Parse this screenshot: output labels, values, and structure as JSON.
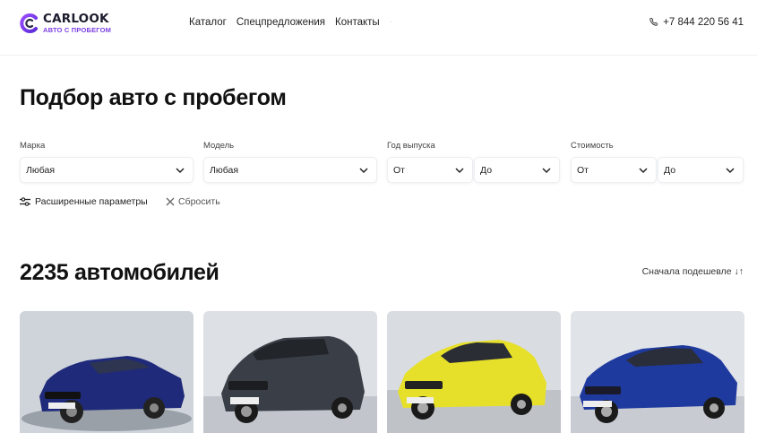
{
  "header": {
    "logo_title": "CARLOOK",
    "logo_subtitle": "АВТО С ПРОБЕГОМ",
    "nav": [
      "Каталог",
      "Спецпредложения",
      "Контакты"
    ],
    "phone": "+7 844 220 56 41"
  },
  "main": {
    "title": "Подбор авто с пробегом",
    "filters": {
      "brand": {
        "label": "Марка",
        "value": "Любая"
      },
      "model": {
        "label": "Модель",
        "value": "Любая"
      },
      "year": {
        "label": "Год выпуска",
        "from": "От",
        "to": "До"
      },
      "price": {
        "label": "Стоимость",
        "from": "От",
        "to": "До"
      }
    },
    "advanced_label": "Расширенные параметры",
    "reset_label": "Сбросить",
    "count_title": "2235 автомобилей",
    "sort_label": "Сначала подешевле ↓↑"
  },
  "cars": [
    {
      "color": "#1f2b7a",
      "bg": "#d9dde3",
      "icon": "car-photo"
    },
    {
      "color": "#3a3f47",
      "bg": "#e4e6ea",
      "icon": "car-photo"
    },
    {
      "color": "#e6e02a",
      "bg": "#dcdfe4",
      "icon": "car-photo"
    },
    {
      "color": "#1f3a9e",
      "bg": "#e0e3e8",
      "icon": "car-photo"
    }
  ],
  "colors": {
    "accent": "#7b3fe4",
    "text": "#111111"
  }
}
